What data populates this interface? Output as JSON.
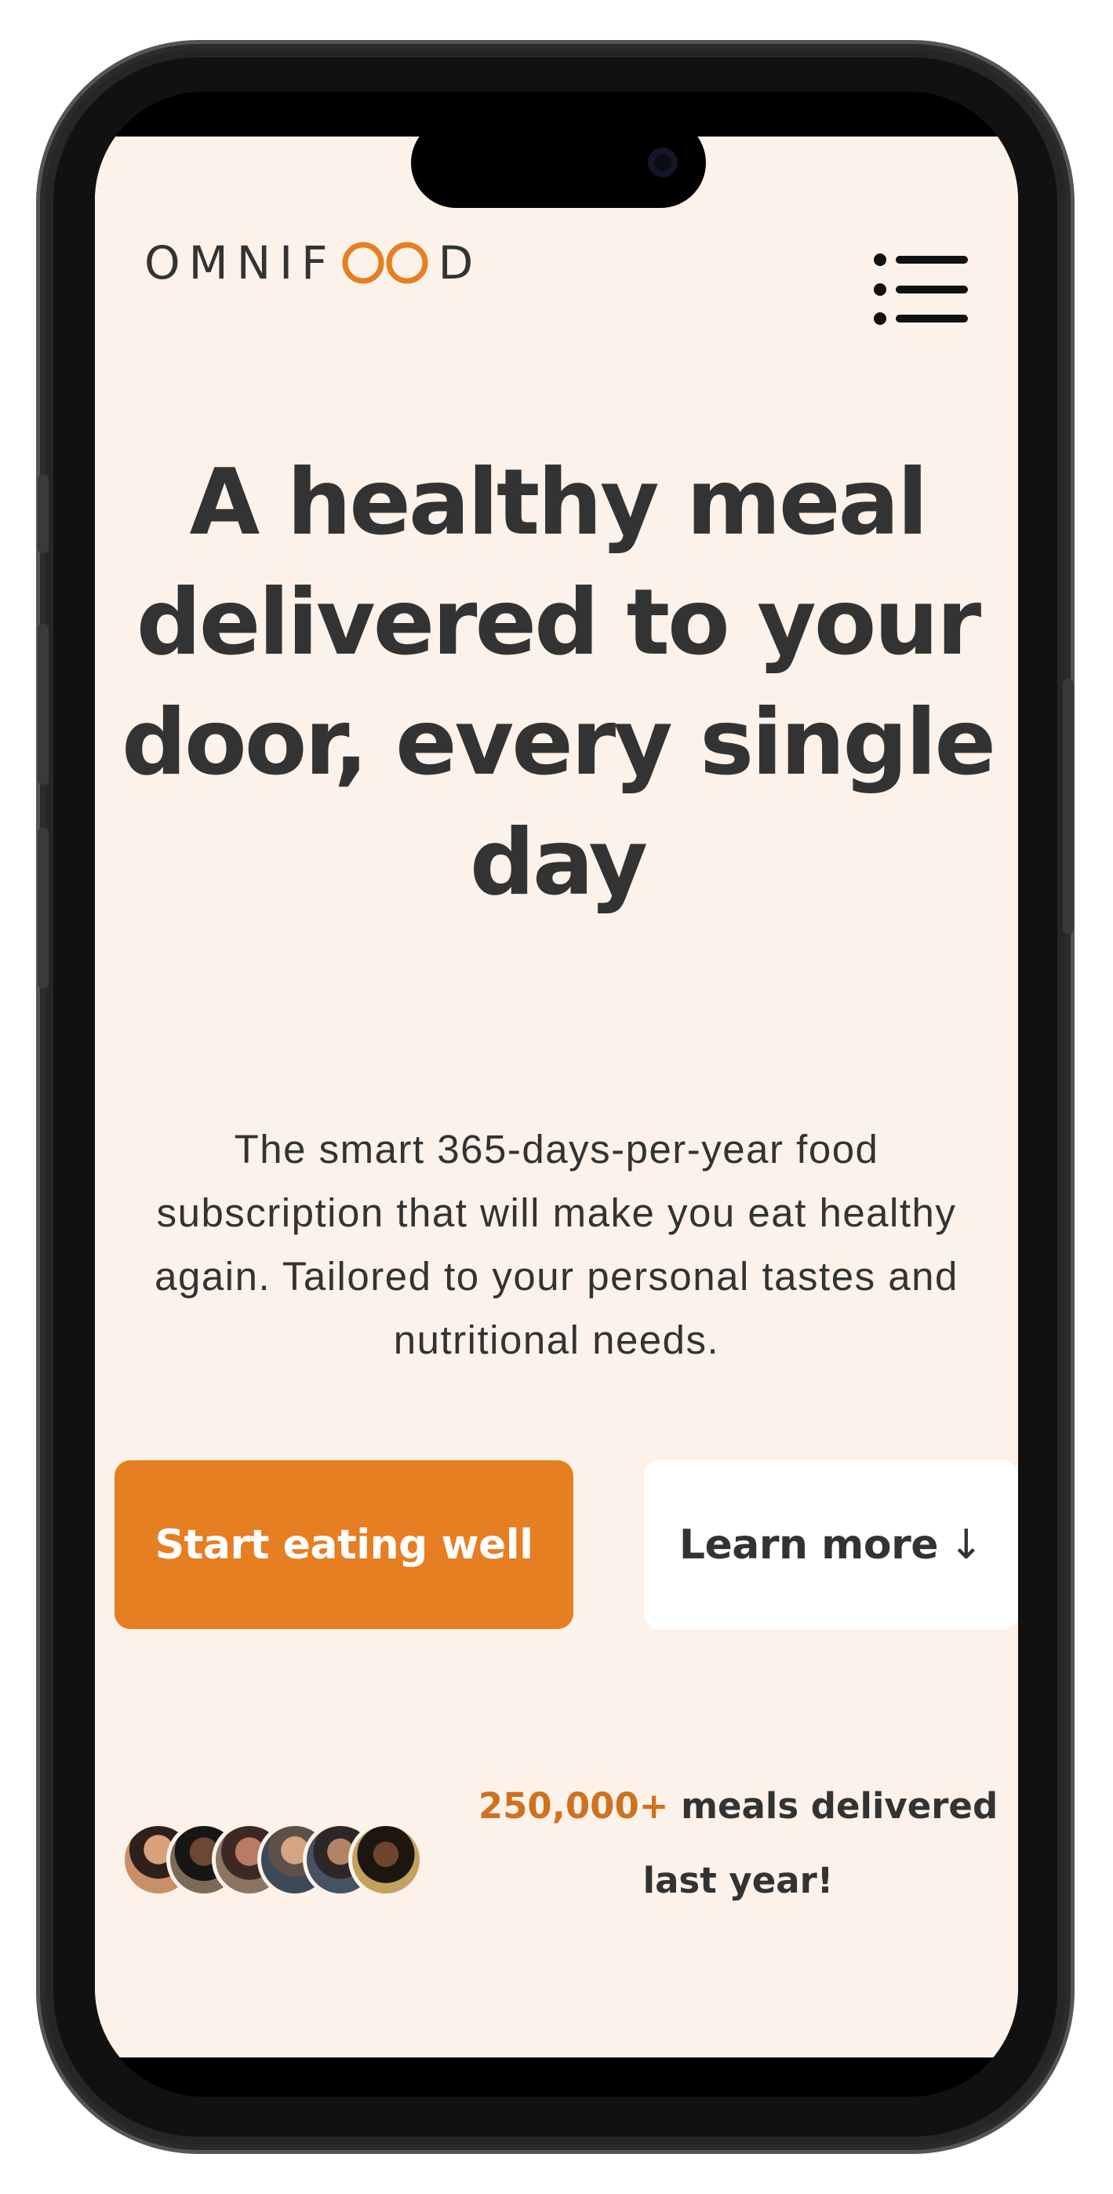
{
  "header": {
    "logo": {
      "text_before": "OMNIF",
      "text_after": "D",
      "accent_color": "#e67e22"
    },
    "menu_icon": "menu-icon"
  },
  "hero": {
    "title": "A healthy meal delivered to your door, every single day",
    "description": "The smart 365-days-per-year food subscription that will make you eat healthy again. Tailored to your personal tastes and nutritional needs.",
    "primary_button": "Start eating well",
    "secondary_button": "Learn more",
    "secondary_button_icon": "↓"
  },
  "delivered": {
    "number": "250,000+",
    "text": " meals delivered last year!",
    "avatars": [
      "customer-avatar-1",
      "customer-avatar-2",
      "customer-avatar-3",
      "customer-avatar-4",
      "customer-avatar-5",
      "customer-avatar-6"
    ]
  },
  "colors": {
    "background": "#fdf2e9",
    "primary": "#e67e22",
    "text": "#333333",
    "button_secondary": "#ffffff"
  }
}
